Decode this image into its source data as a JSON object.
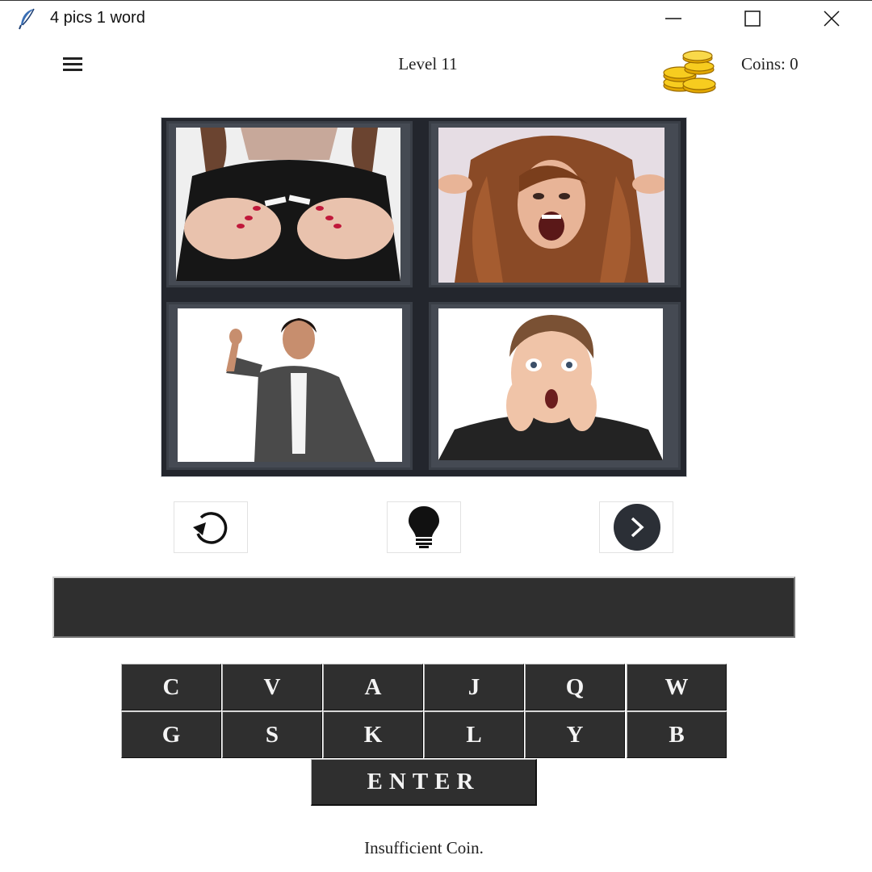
{
  "window": {
    "title": "4 pics 1 word",
    "controls": [
      "minimize",
      "maximize",
      "close"
    ]
  },
  "header": {
    "menu_icon": "hamburger-menu-icon",
    "level": "Level 11",
    "coins_icon": "gold-coins-icon",
    "coins_label": "Coins: 0"
  },
  "pictures": [
    {
      "name": "broken-cigarette-photo"
    },
    {
      "name": "screaming-woman-photo"
    },
    {
      "name": "businesswoman-pinch-gesture-photo"
    },
    {
      "name": "shocked-young-man-photo"
    }
  ],
  "controls": {
    "reset_icon": "undo-icon",
    "hint_icon": "light-bulb-icon",
    "next_icon": "chevron-right-circle-icon"
  },
  "answer": {
    "value": ""
  },
  "keyboard": {
    "row1": [
      "C",
      "V",
      "A",
      "J",
      "Q",
      "W"
    ],
    "row2": [
      "G",
      "S",
      "K",
      "L",
      "Y",
      "B"
    ],
    "enter_label": "ENTER"
  },
  "status_message": "Insufficient Coin.",
  "colors": {
    "key_bg": "#2f2f2f",
    "key_text": "#f4f4f4",
    "grid_bg": "#23262d",
    "coin_gold": "#f2c200"
  }
}
